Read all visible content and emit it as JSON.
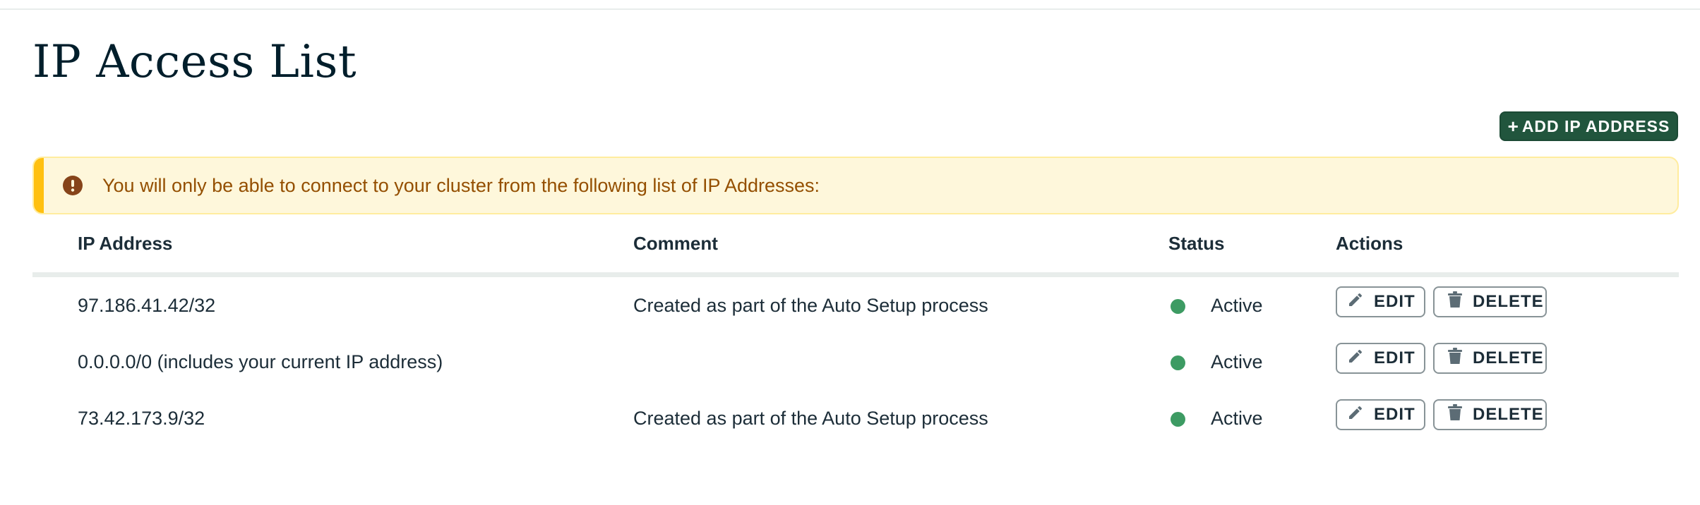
{
  "page": {
    "title": "IP Access List",
    "add_button_label": "ADD IP ADDRESS",
    "add_button_icon": "plus-icon"
  },
  "banner": {
    "icon": "warning-icon",
    "text": "You will only be able to connect to your cluster from the following list of IP Addresses:"
  },
  "table": {
    "headers": {
      "ip_address": "IP Address",
      "comment": "Comment",
      "status": "Status",
      "actions": "Actions"
    },
    "rows": [
      {
        "ip": "97.186.41.42/32",
        "comment": "Created as part of the Auto Setup process",
        "status": "Active",
        "edit": "EDIT",
        "delete": "DELETE"
      },
      {
        "ip": "0.0.0.0/0 (includes your current IP address)",
        "comment": "",
        "status": "Active",
        "edit": "EDIT",
        "delete": "DELETE"
      },
      {
        "ip": "73.42.173.9/32",
        "comment": "Created as part of the Auto Setup process",
        "status": "Active",
        "edit": "EDIT",
        "delete": "DELETE"
      }
    ]
  },
  "colors": {
    "accent_button": "#21553d",
    "banner_bg": "#fef7db",
    "banner_bar": "#ffc010",
    "banner_text": "#944f01",
    "status_active": "#3d9b63"
  }
}
